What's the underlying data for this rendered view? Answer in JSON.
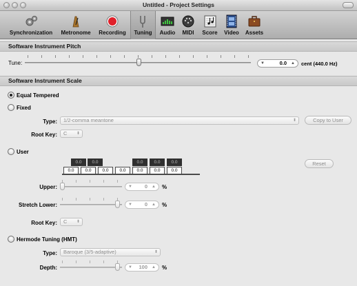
{
  "window": {
    "title": "Untitled - Project Settings"
  },
  "toolbar": {
    "items": [
      {
        "label": "Synchronization",
        "icon": "synchronization-gears-icon"
      },
      {
        "label": "Metronome",
        "icon": "metronome-icon"
      },
      {
        "label": "Recording",
        "icon": "record-icon"
      },
      {
        "label": "Tuning",
        "icon": "tuning-fork-icon",
        "active": true
      },
      {
        "label": "Audio",
        "icon": "audio-meter-icon"
      },
      {
        "label": "MIDI",
        "icon": "midi-plug-icon"
      },
      {
        "label": "Score",
        "icon": "score-notes-icon"
      },
      {
        "label": "Video",
        "icon": "video-film-icon"
      },
      {
        "label": "Assets",
        "icon": "assets-briefcase-icon"
      }
    ]
  },
  "pitch": {
    "header": "Software Instrument Pitch",
    "tune_label": "Tune:",
    "value": "0.0",
    "unit_text": "cent (440.0 Hz)"
  },
  "scale": {
    "header": "Software Instrument Scale",
    "equal_tempered": "Equal Tempered",
    "fixed": "Fixed",
    "type_label": "Type:",
    "type_value": "1/2-comma meantone",
    "copy_to_user": "Copy to User",
    "root_key_label": "Root Key:",
    "root_key_value": "C",
    "user": "User",
    "black_keys": [
      "0.0",
      "0.0",
      "0.0",
      "0.0",
      "0.0"
    ],
    "white_keys": [
      "0.0",
      "0.0",
      "0.0",
      "0.0",
      "0.0",
      "0.0",
      "0.0"
    ],
    "reset": "Reset",
    "upper_label": "Upper:",
    "upper_value": "0",
    "stretch_lower_label": "Stretch Lower:",
    "stretch_lower_value": "0",
    "percent": "%",
    "user_root_key_label": "Root Key:",
    "user_root_key_value": "C",
    "hermode": "Hermode Tuning (HMT)",
    "hmt_type_label": "Type:",
    "hmt_type_value": "Baroque (3/5-adaptive)",
    "depth_label": "Depth:",
    "depth_value": "100"
  },
  "colors": {
    "window_bg": "#e8e8e8",
    "record_red": "#e0202a",
    "section_bg": "#d2d2d2"
  }
}
